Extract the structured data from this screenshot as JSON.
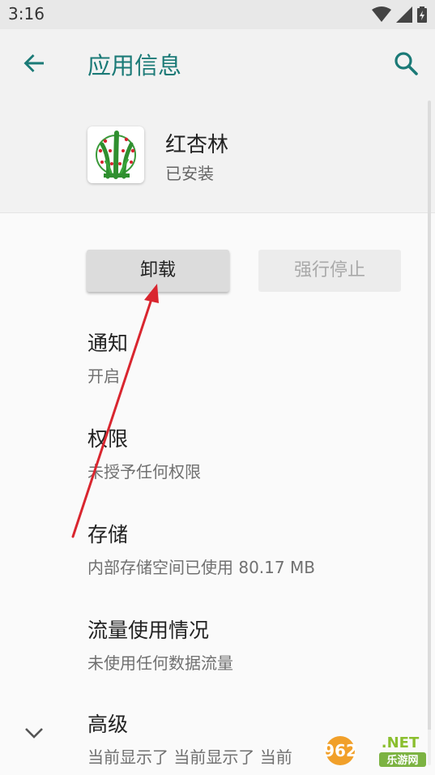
{
  "status_bar": {
    "time": "3:16"
  },
  "app_bar": {
    "title": "应用信息",
    "back_icon": "arrow-back-icon",
    "search_icon": "search-icon"
  },
  "header": {
    "app_name": "红杏林",
    "install_status": "已安装"
  },
  "buttons": {
    "uninstall": "卸载",
    "force_stop": "强行停止"
  },
  "settings": [
    {
      "title": "通知",
      "subtitle": "开启"
    },
    {
      "title": "权限",
      "subtitle": "未授予任何权限"
    },
    {
      "title": "存储",
      "subtitle": "内部存储空间已使用 80.17 MB"
    },
    {
      "title": "流量使用情况",
      "subtitle": "未使用任何数据流量"
    },
    {
      "title": "高级",
      "subtitle": "当前显示了 当前显示了 当前"
    }
  ],
  "watermark": {
    "number": "962",
    "suffix": ".NET",
    "site": "乐游网"
  },
  "colors": {
    "accent": "#1b7a77",
    "arrow": "#d9262f"
  }
}
